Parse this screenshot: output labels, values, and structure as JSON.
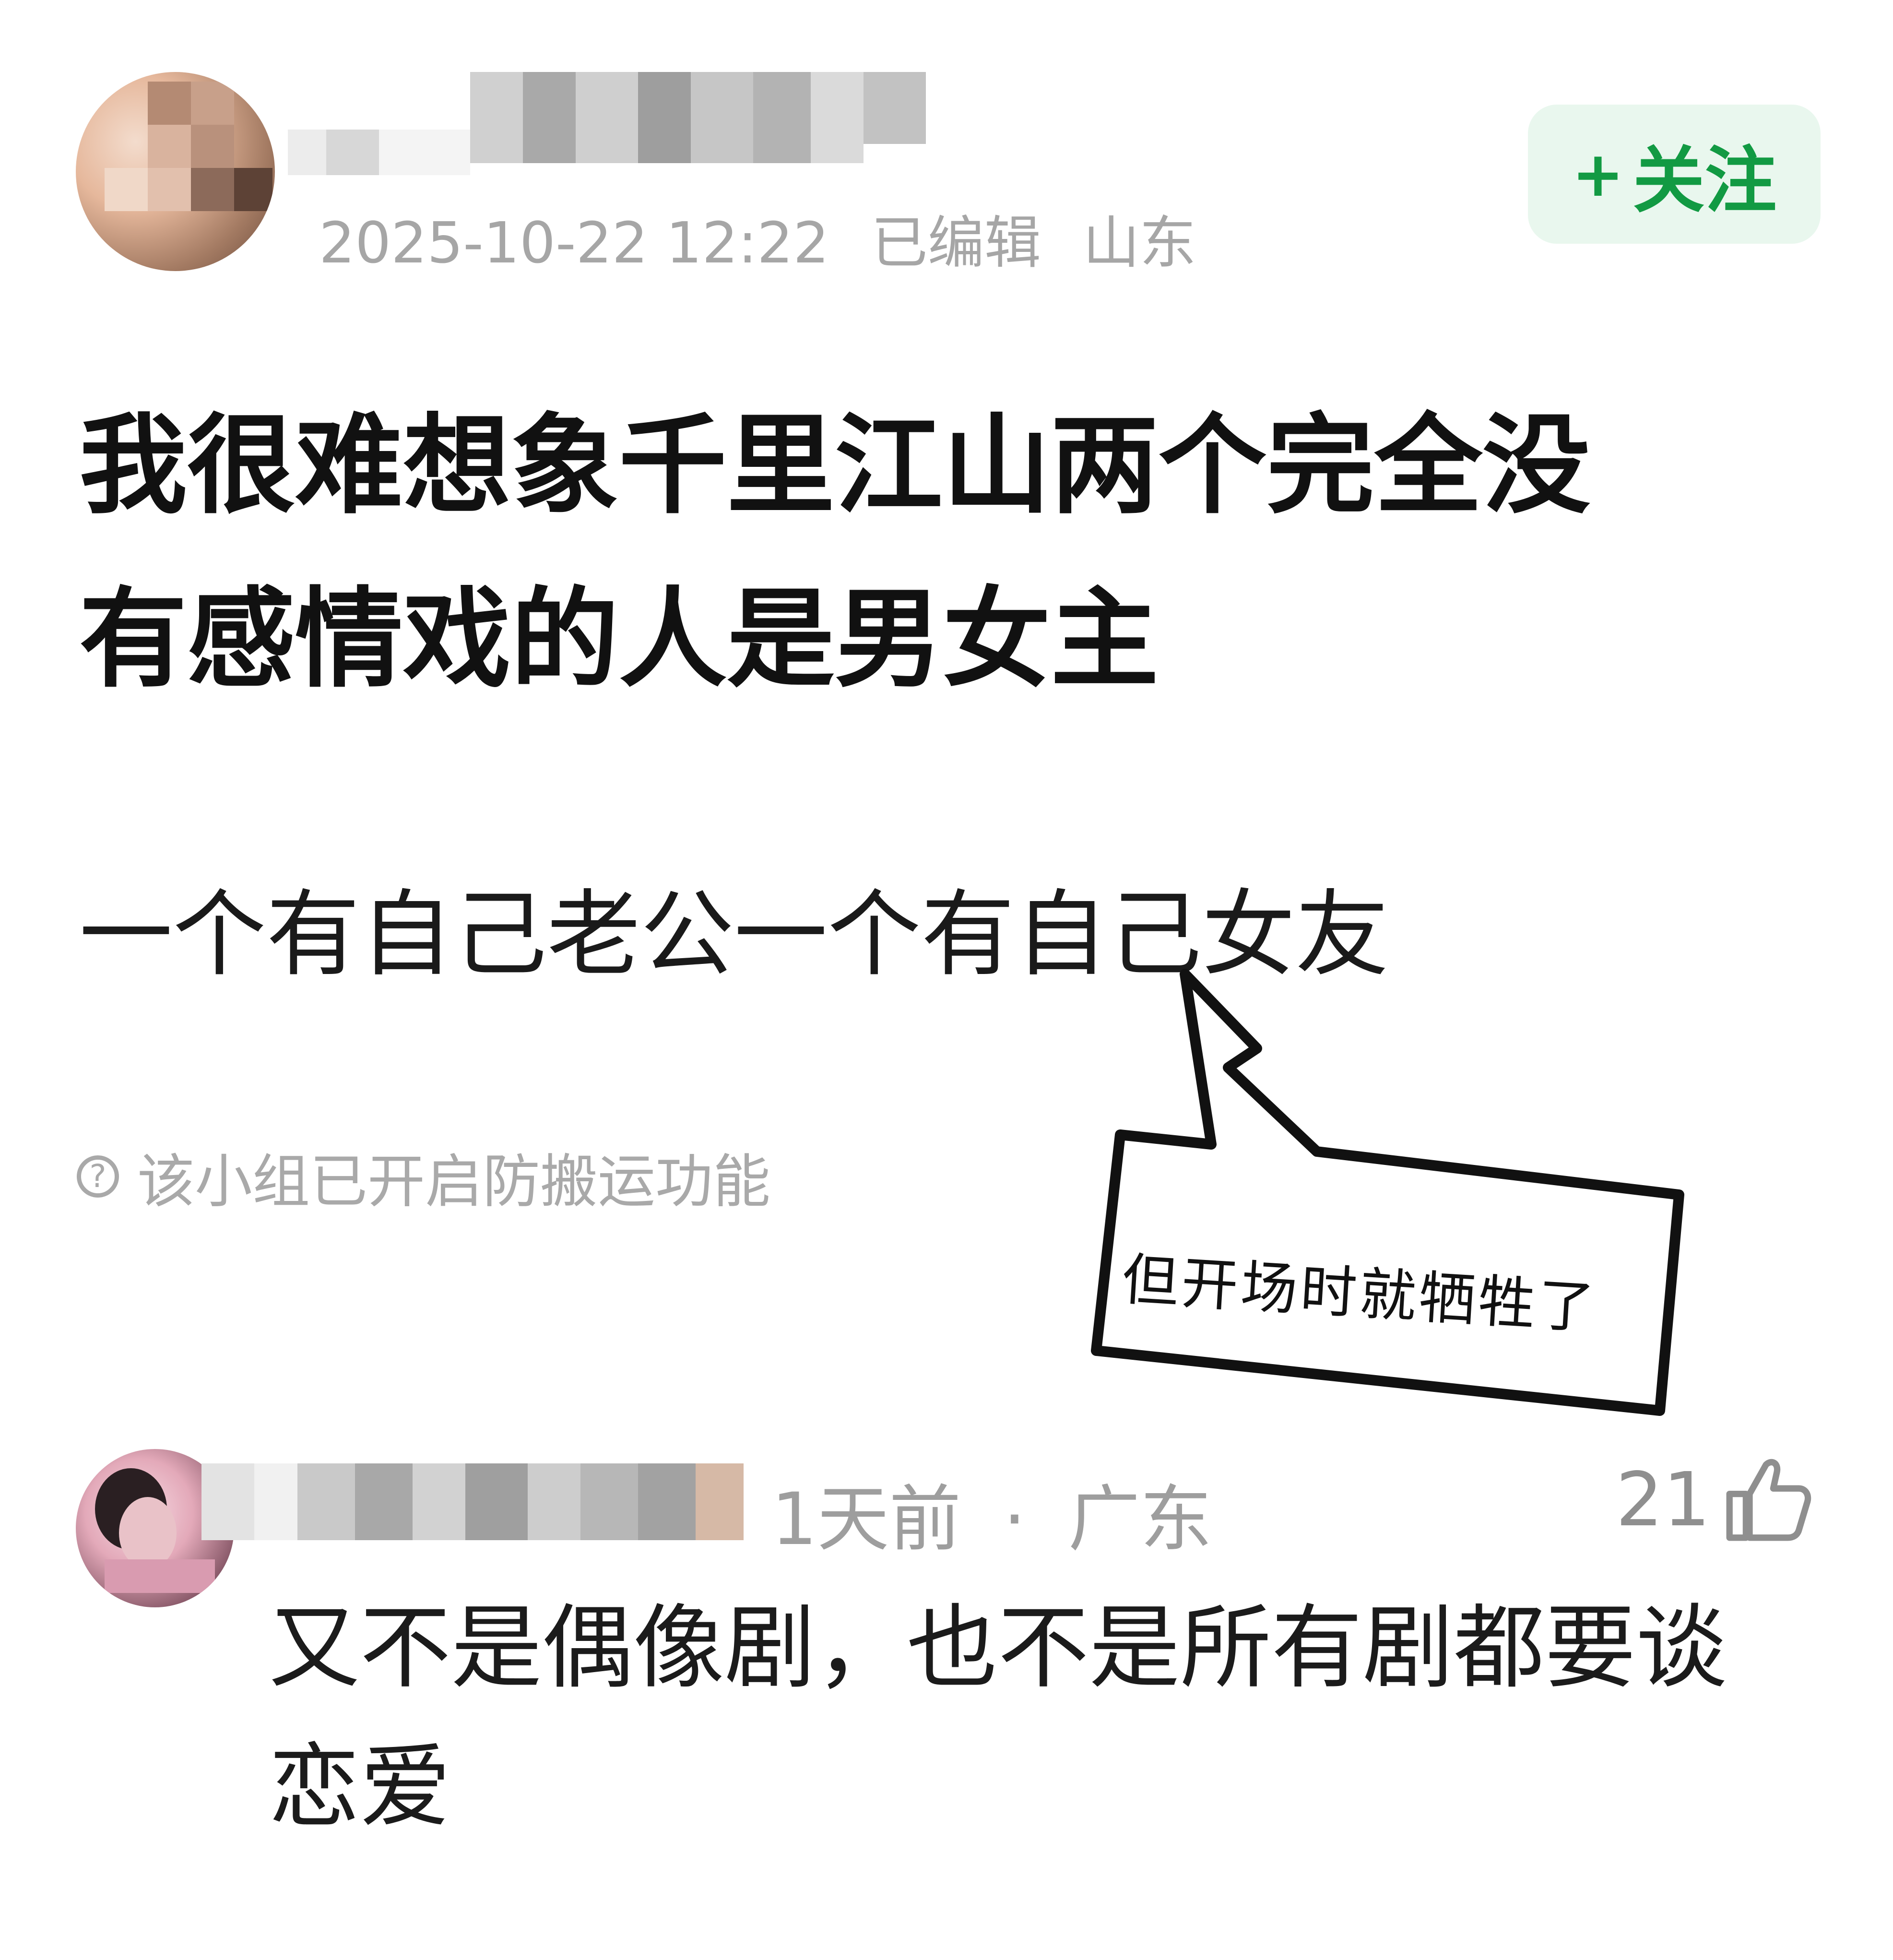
{
  "post": {
    "timestamp": "2025-10-22 12:22",
    "edited": "已编辑",
    "location": "山东",
    "follow_label": "关注",
    "follow_plus": "+",
    "title_line1": "我很难想象千里江山两个完全没",
    "title_line2": "有感情戏的人是男女主",
    "body": "一个有自己老公一个有自己女友",
    "anti_copy_notice": "该小组已开启防搬运功能",
    "help_glyph": "?"
  },
  "annotation": {
    "bubble_text": "但开场时就牺牲了"
  },
  "comment": {
    "time": "1天前",
    "separator": "·",
    "location": "广东",
    "likes": "21",
    "text_line1": "又不是偶像剧，也不是所有剧都要谈",
    "text_line2": "恋爱"
  },
  "icons": {
    "help": "question-circle-icon",
    "like": "thumbs-up-icon"
  },
  "colors": {
    "follow_text": "#129a43",
    "follow_bg": "#e9f7ee",
    "meta_gray": "#a6a6a6"
  }
}
